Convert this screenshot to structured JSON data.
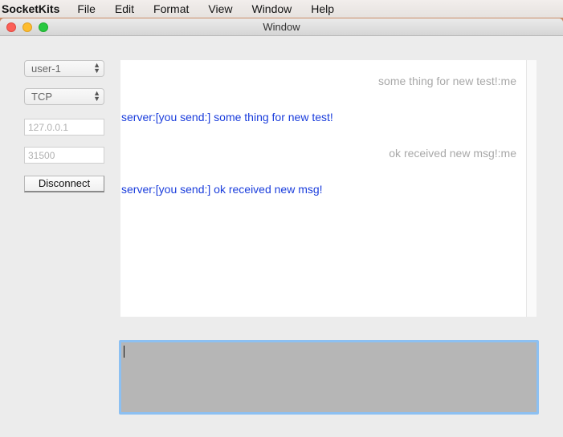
{
  "menubar": {
    "app_name": "SocketKits",
    "items": [
      "File",
      "Edit",
      "Format",
      "View",
      "Window",
      "Help"
    ]
  },
  "window": {
    "title": "Window"
  },
  "sidebar": {
    "user_select": "user-1",
    "protocol_select": "TCP",
    "host_placeholder": "127.0.0.1",
    "port_placeholder": "31500",
    "disconnect_label": "Disconnect"
  },
  "messages": [
    {
      "from": "me",
      "text": "some thing for new test!:me"
    },
    {
      "from": "server",
      "text": "server:[you send:] some thing for new test!"
    },
    {
      "from": "me",
      "text": "ok received new msg!:me"
    },
    {
      "from": "server",
      "text": "server:[you send:] ok received new msg!"
    }
  ],
  "colors": {
    "server_text": "#1a3ddc",
    "me_text": "#a8a8a8",
    "input_focus_ring": "#8cc0f2"
  }
}
